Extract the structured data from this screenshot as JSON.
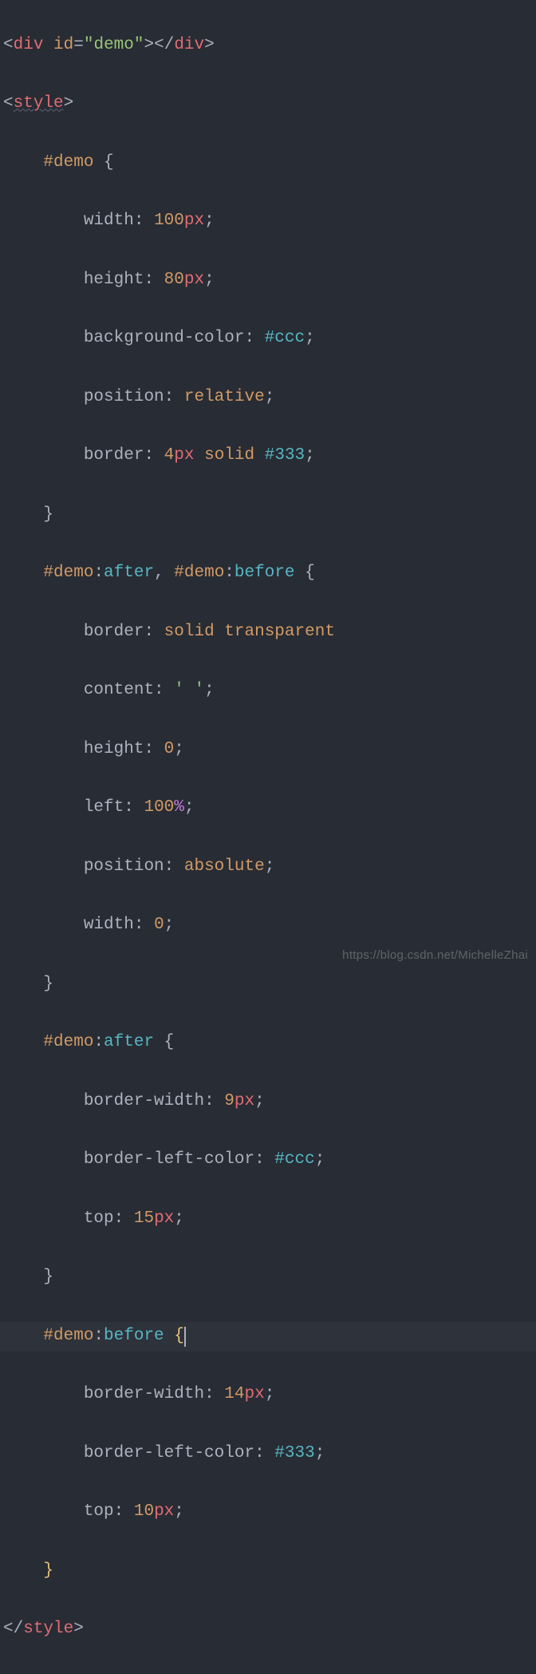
{
  "code": {
    "line1": {
      "lt": "<",
      "tag1": "div",
      "sp": " ",
      "attr": "id",
      "eq": "=",
      "q1": "\"",
      "val": "demo",
      "q2": "\"",
      "gt1": ">",
      "lt2": "</",
      "tag2": "div",
      "gt2": ">"
    },
    "line2": {
      "lt": "<",
      "tag": "style",
      "gt": ">"
    },
    "line3": {
      "indent": "    ",
      "sel": "#demo",
      "sp": " ",
      "brace": "{"
    },
    "line4": {
      "indent": "        ",
      "prop": "width",
      "colon": ": ",
      "num": "100",
      "unit": "px",
      "semi": ";"
    },
    "line5": {
      "indent": "        ",
      "prop": "height",
      "colon": ": ",
      "num": "80",
      "unit": "px",
      "semi": ";"
    },
    "line6": {
      "indent": "        ",
      "prop": "background-color",
      "colon": ": ",
      "color": "#ccc",
      "semi": ";"
    },
    "line7": {
      "indent": "        ",
      "prop": "position",
      "colon": ": ",
      "val": "relative",
      "semi": ";"
    },
    "line8": {
      "indent": "        ",
      "prop": "border",
      "colon": ": ",
      "num": "4",
      "unit": "px",
      "sp": " ",
      "val": "solid",
      "sp2": " ",
      "color": "#333",
      "semi": ";"
    },
    "line9": {
      "indent": "    ",
      "brace": "}"
    },
    "line10": {
      "indent": "    ",
      "sel1": "#demo",
      "colon1": ":",
      "ps1": "after",
      "comma": ", ",
      "sel2": "#demo",
      "colon2": ":",
      "ps2": "before",
      "sp": " ",
      "brace": "{"
    },
    "line11": {
      "indent": "        ",
      "prop": "border",
      "colon": ": ",
      "val1": "solid",
      "sp": " ",
      "val2": "transparent"
    },
    "line12": {
      "indent": "        ",
      "prop": "content",
      "colon": ": ",
      "q1": "'",
      "val": " ",
      "q2": "'",
      "semi": ";"
    },
    "line13": {
      "indent": "        ",
      "prop": "height",
      "colon": ": ",
      "num": "0",
      "semi": ";"
    },
    "line14": {
      "indent": "        ",
      "prop": "left",
      "colon": ": ",
      "num": "100",
      "pct": "%",
      "semi": ";"
    },
    "line15": {
      "indent": "        ",
      "prop": "position",
      "colon": ": ",
      "val": "absolute",
      "semi": ";"
    },
    "line16": {
      "indent": "        ",
      "prop": "width",
      "colon": ": ",
      "num": "0",
      "semi": ";"
    },
    "line17": {
      "indent": "    ",
      "brace": "}"
    },
    "line18": {
      "indent": "    ",
      "sel": "#demo",
      "colon": ":",
      "ps": "after",
      "sp": " ",
      "brace": "{"
    },
    "line19": {
      "indent": "        ",
      "prop": "border-width",
      "colon": ": ",
      "num": "9",
      "unit": "px",
      "semi": ";"
    },
    "line20": {
      "indent": "        ",
      "prop": "border-left-color",
      "colon": ": ",
      "color": "#ccc",
      "semi": ";"
    },
    "line21": {
      "indent": "        ",
      "prop": "top",
      "colon": ": ",
      "num": "15",
      "unit": "px",
      "semi": ";"
    },
    "line22": {
      "indent": "    ",
      "brace": "}"
    },
    "line23": {
      "indent": "    ",
      "sel": "#demo",
      "colon": ":",
      "ps": "before",
      "sp": " ",
      "brace": "{"
    },
    "line24": {
      "indent": "        ",
      "prop": "border-width",
      "colon": ": ",
      "num": "14",
      "unit": "px",
      "semi": ";"
    },
    "line25": {
      "indent": "        ",
      "prop": "border-left-color",
      "colon": ": ",
      "color": "#333",
      "semi": ";"
    },
    "line26": {
      "indent": "        ",
      "prop": "top",
      "colon": ": ",
      "num": "10",
      "unit": "px",
      "semi": ";"
    },
    "line27": {
      "indent": "    ",
      "brace": "}"
    },
    "line28": {
      "lt": "</",
      "tag": "style",
      "gt": ">"
    }
  },
  "watermark": "https://blog.csdn.net/MichelleZhai"
}
